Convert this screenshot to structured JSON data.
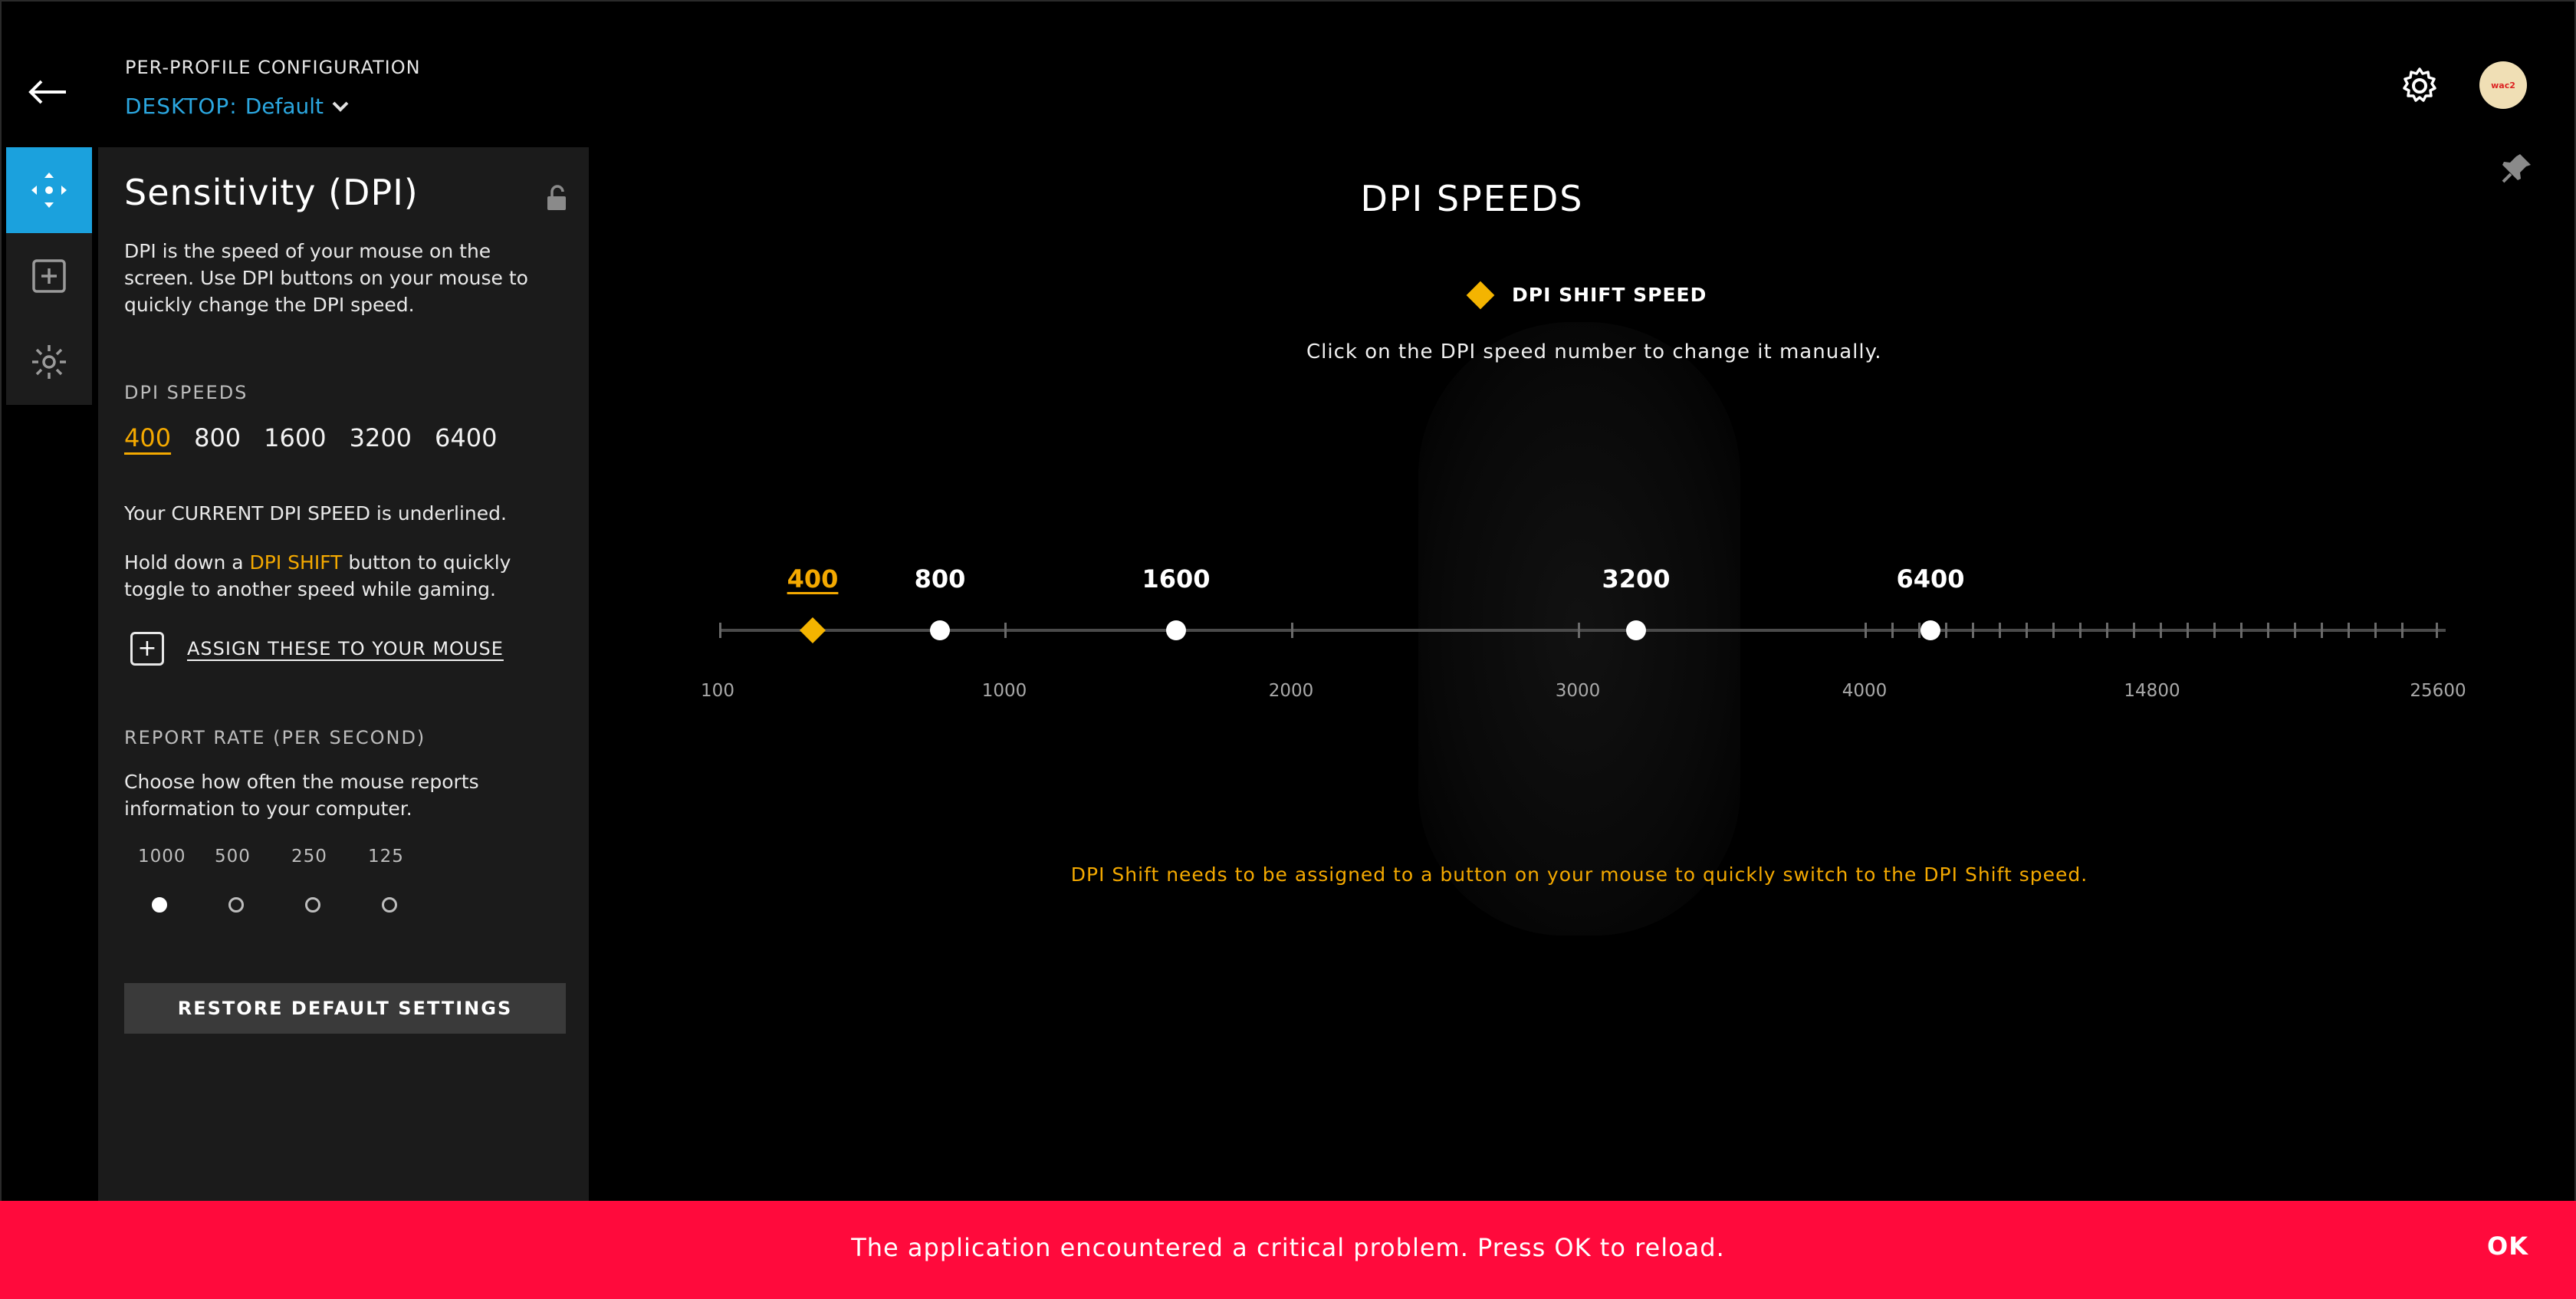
{
  "header": {
    "profile_label": "PER-PROFILE CONFIGURATION",
    "profile_key": "DESKTOP:",
    "profile_value": "Default"
  },
  "avatar_text": "wac2",
  "panel": {
    "title": "Sensitivity (DPI)",
    "description": "DPI is the speed of your mouse on the screen. Use DPI buttons on your mouse to quickly change the DPI speed.",
    "dpi_heading": "DPI SPEEDS",
    "dpi_speeds": [
      "400",
      "800",
      "1600",
      "3200",
      "6400"
    ],
    "current_note": "Your CURRENT DPI SPEED is underlined.",
    "shift_pre": "Hold down a ",
    "shift_word": "DPI SHIFT",
    "shift_post": " button to quickly toggle to another speed while gaming.",
    "assign_label": "ASSIGN THESE TO YOUR MOUSE",
    "report_heading": "REPORT RATE (PER SECOND)",
    "report_desc": "Choose how often the mouse reports information to your computer.",
    "report_rates": [
      "1000",
      "500",
      "250",
      "125"
    ],
    "report_selected": "1000",
    "restore_label": "RESTORE DEFAULT SETTINGS"
  },
  "main": {
    "title": "DPI SPEEDS",
    "shift_legend": "DPI SHIFT SPEED",
    "hint": "Click on the DPI speed number to change it manually.",
    "warning": "DPI Shift needs to be assigned to a button on your mouse to quickly switch to the DPI Shift speed."
  },
  "slider": {
    "axis_labels": [
      "100",
      "1000",
      "2000",
      "3000",
      "4000",
      "14800",
      "25600"
    ],
    "shift_speed": "400",
    "speeds": [
      "800",
      "1600",
      "3200",
      "6400"
    ]
  },
  "error": {
    "message": "The application encountered a critical problem. Press OK to reload.",
    "ok_label": "OK"
  },
  "colors": {
    "accent_blue": "#1ba1dd",
    "shift_yellow": "#f4b400",
    "error_red": "#ff0a3c"
  }
}
